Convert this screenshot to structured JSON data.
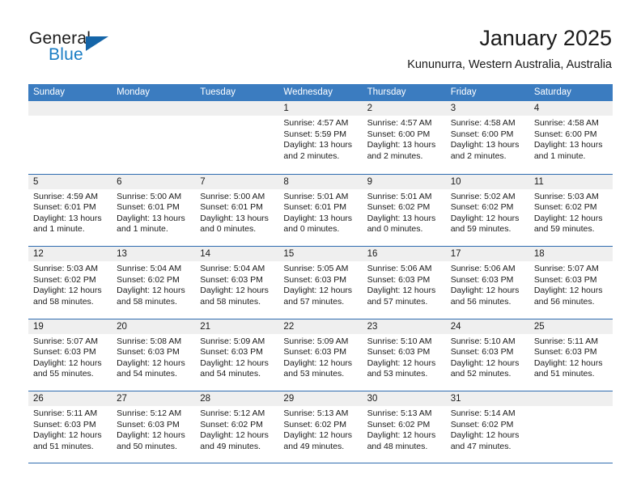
{
  "brand": {
    "name_part1": "General",
    "name_part2": "Blue",
    "accent_color": "#1a7dc4",
    "triangle_color": "#1565a8"
  },
  "header": {
    "title": "January 2025",
    "location": "Kununurra, Western Australia, Australia"
  },
  "calendar": {
    "header_color": "#3b7cc0",
    "row_divider_color": "#2f6cb0",
    "day_number_band_color": "#efefef",
    "weekdays": [
      "Sunday",
      "Monday",
      "Tuesday",
      "Wednesday",
      "Thursday",
      "Friday",
      "Saturday"
    ],
    "weeks": [
      [
        {
          "day": "",
          "sunrise": "",
          "sunset": "",
          "daylight": "",
          "daylight2": ""
        },
        {
          "day": "",
          "sunrise": "",
          "sunset": "",
          "daylight": "",
          "daylight2": ""
        },
        {
          "day": "",
          "sunrise": "",
          "sunset": "",
          "daylight": "",
          "daylight2": ""
        },
        {
          "day": "1",
          "sunrise": "Sunrise: 4:57 AM",
          "sunset": "Sunset: 5:59 PM",
          "daylight": "Daylight: 13 hours",
          "daylight2": "and 2 minutes."
        },
        {
          "day": "2",
          "sunrise": "Sunrise: 4:57 AM",
          "sunset": "Sunset: 6:00 PM",
          "daylight": "Daylight: 13 hours",
          "daylight2": "and 2 minutes."
        },
        {
          "day": "3",
          "sunrise": "Sunrise: 4:58 AM",
          "sunset": "Sunset: 6:00 PM",
          "daylight": "Daylight: 13 hours",
          "daylight2": "and 2 minutes."
        },
        {
          "day": "4",
          "sunrise": "Sunrise: 4:58 AM",
          "sunset": "Sunset: 6:00 PM",
          "daylight": "Daylight: 13 hours",
          "daylight2": "and 1 minute."
        }
      ],
      [
        {
          "day": "5",
          "sunrise": "Sunrise: 4:59 AM",
          "sunset": "Sunset: 6:01 PM",
          "daylight": "Daylight: 13 hours",
          "daylight2": "and 1 minute."
        },
        {
          "day": "6",
          "sunrise": "Sunrise: 5:00 AM",
          "sunset": "Sunset: 6:01 PM",
          "daylight": "Daylight: 13 hours",
          "daylight2": "and 1 minute."
        },
        {
          "day": "7",
          "sunrise": "Sunrise: 5:00 AM",
          "sunset": "Sunset: 6:01 PM",
          "daylight": "Daylight: 13 hours",
          "daylight2": "and 0 minutes."
        },
        {
          "day": "8",
          "sunrise": "Sunrise: 5:01 AM",
          "sunset": "Sunset: 6:01 PM",
          "daylight": "Daylight: 13 hours",
          "daylight2": "and 0 minutes."
        },
        {
          "day": "9",
          "sunrise": "Sunrise: 5:01 AM",
          "sunset": "Sunset: 6:02 PM",
          "daylight": "Daylight: 13 hours",
          "daylight2": "and 0 minutes."
        },
        {
          "day": "10",
          "sunrise": "Sunrise: 5:02 AM",
          "sunset": "Sunset: 6:02 PM",
          "daylight": "Daylight: 12 hours",
          "daylight2": "and 59 minutes."
        },
        {
          "day": "11",
          "sunrise": "Sunrise: 5:03 AM",
          "sunset": "Sunset: 6:02 PM",
          "daylight": "Daylight: 12 hours",
          "daylight2": "and 59 minutes."
        }
      ],
      [
        {
          "day": "12",
          "sunrise": "Sunrise: 5:03 AM",
          "sunset": "Sunset: 6:02 PM",
          "daylight": "Daylight: 12 hours",
          "daylight2": "and 58 minutes."
        },
        {
          "day": "13",
          "sunrise": "Sunrise: 5:04 AM",
          "sunset": "Sunset: 6:02 PM",
          "daylight": "Daylight: 12 hours",
          "daylight2": "and 58 minutes."
        },
        {
          "day": "14",
          "sunrise": "Sunrise: 5:04 AM",
          "sunset": "Sunset: 6:03 PM",
          "daylight": "Daylight: 12 hours",
          "daylight2": "and 58 minutes."
        },
        {
          "day": "15",
          "sunrise": "Sunrise: 5:05 AM",
          "sunset": "Sunset: 6:03 PM",
          "daylight": "Daylight: 12 hours",
          "daylight2": "and 57 minutes."
        },
        {
          "day": "16",
          "sunrise": "Sunrise: 5:06 AM",
          "sunset": "Sunset: 6:03 PM",
          "daylight": "Daylight: 12 hours",
          "daylight2": "and 57 minutes."
        },
        {
          "day": "17",
          "sunrise": "Sunrise: 5:06 AM",
          "sunset": "Sunset: 6:03 PM",
          "daylight": "Daylight: 12 hours",
          "daylight2": "and 56 minutes."
        },
        {
          "day": "18",
          "sunrise": "Sunrise: 5:07 AM",
          "sunset": "Sunset: 6:03 PM",
          "daylight": "Daylight: 12 hours",
          "daylight2": "and 56 minutes."
        }
      ],
      [
        {
          "day": "19",
          "sunrise": "Sunrise: 5:07 AM",
          "sunset": "Sunset: 6:03 PM",
          "daylight": "Daylight: 12 hours",
          "daylight2": "and 55 minutes."
        },
        {
          "day": "20",
          "sunrise": "Sunrise: 5:08 AM",
          "sunset": "Sunset: 6:03 PM",
          "daylight": "Daylight: 12 hours",
          "daylight2": "and 54 minutes."
        },
        {
          "day": "21",
          "sunrise": "Sunrise: 5:09 AM",
          "sunset": "Sunset: 6:03 PM",
          "daylight": "Daylight: 12 hours",
          "daylight2": "and 54 minutes."
        },
        {
          "day": "22",
          "sunrise": "Sunrise: 5:09 AM",
          "sunset": "Sunset: 6:03 PM",
          "daylight": "Daylight: 12 hours",
          "daylight2": "and 53 minutes."
        },
        {
          "day": "23",
          "sunrise": "Sunrise: 5:10 AM",
          "sunset": "Sunset: 6:03 PM",
          "daylight": "Daylight: 12 hours",
          "daylight2": "and 53 minutes."
        },
        {
          "day": "24",
          "sunrise": "Sunrise: 5:10 AM",
          "sunset": "Sunset: 6:03 PM",
          "daylight": "Daylight: 12 hours",
          "daylight2": "and 52 minutes."
        },
        {
          "day": "25",
          "sunrise": "Sunrise: 5:11 AM",
          "sunset": "Sunset: 6:03 PM",
          "daylight": "Daylight: 12 hours",
          "daylight2": "and 51 minutes."
        }
      ],
      [
        {
          "day": "26",
          "sunrise": "Sunrise: 5:11 AM",
          "sunset": "Sunset: 6:03 PM",
          "daylight": "Daylight: 12 hours",
          "daylight2": "and 51 minutes."
        },
        {
          "day": "27",
          "sunrise": "Sunrise: 5:12 AM",
          "sunset": "Sunset: 6:03 PM",
          "daylight": "Daylight: 12 hours",
          "daylight2": "and 50 minutes."
        },
        {
          "day": "28",
          "sunrise": "Sunrise: 5:12 AM",
          "sunset": "Sunset: 6:02 PM",
          "daylight": "Daylight: 12 hours",
          "daylight2": "and 49 minutes."
        },
        {
          "day": "29",
          "sunrise": "Sunrise: 5:13 AM",
          "sunset": "Sunset: 6:02 PM",
          "daylight": "Daylight: 12 hours",
          "daylight2": "and 49 minutes."
        },
        {
          "day": "30",
          "sunrise": "Sunrise: 5:13 AM",
          "sunset": "Sunset: 6:02 PM",
          "daylight": "Daylight: 12 hours",
          "daylight2": "and 48 minutes."
        },
        {
          "day": "31",
          "sunrise": "Sunrise: 5:14 AM",
          "sunset": "Sunset: 6:02 PM",
          "daylight": "Daylight: 12 hours",
          "daylight2": "and 47 minutes."
        },
        {
          "day": "",
          "sunrise": "",
          "sunset": "",
          "daylight": "",
          "daylight2": ""
        }
      ]
    ]
  }
}
